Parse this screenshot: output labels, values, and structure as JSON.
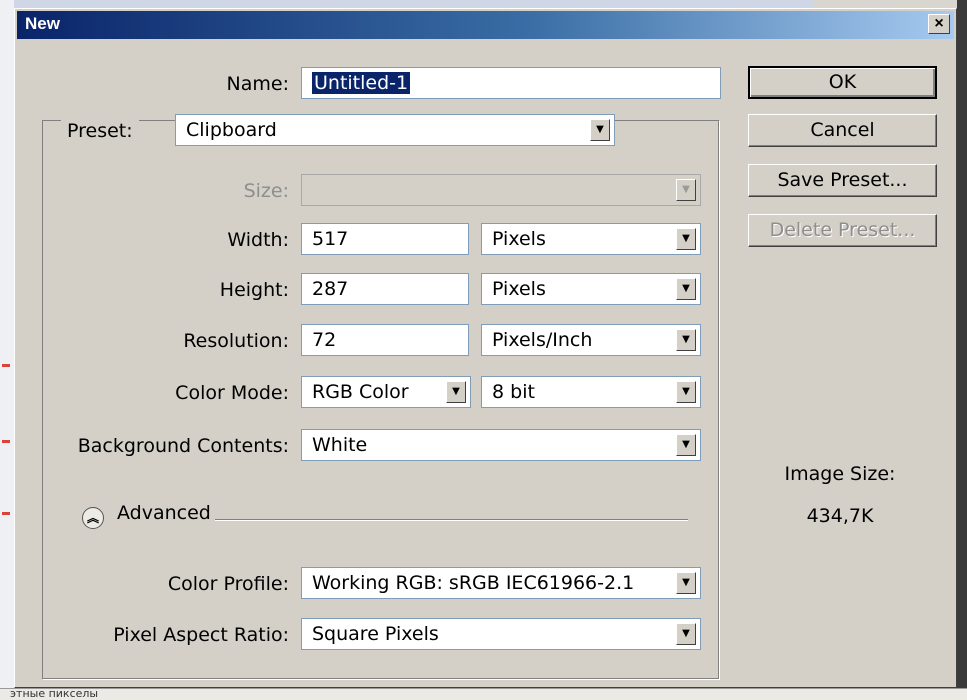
{
  "background": {
    "bottom_text": "этные пикселы"
  },
  "dialog": {
    "title": "New",
    "close_glyph": "×"
  },
  "form": {
    "name_label": "Name:",
    "name_value": "Untitled-1",
    "preset_label": "Preset:",
    "preset_value": "Clipboard",
    "size_label": "Size:",
    "size_value": "",
    "width_label": "Width:",
    "width_value": "517",
    "width_unit": "Pixels",
    "height_label": "Height:",
    "height_value": "287",
    "height_unit": "Pixels",
    "resolution_label": "Resolution:",
    "resolution_value": "72",
    "resolution_unit": "Pixels/Inch",
    "color_mode_label": "Color Mode:",
    "color_mode_value": "RGB Color",
    "bit_depth_value": "8 bit",
    "background_label": "Background Contents:",
    "background_value": "White",
    "advanced_label": "Advanced",
    "color_profile_label": "Color Profile:",
    "color_profile_value": "Working RGB:  sRGB IEC61966-2.1",
    "aspect_label": "Pixel Aspect Ratio:",
    "aspect_value": "Square Pixels"
  },
  "buttons": {
    "ok": "OK",
    "cancel": "Cancel",
    "save_preset": "Save Preset...",
    "delete_preset": "Delete Preset..."
  },
  "info": {
    "image_size_label": "Image Size:",
    "image_size_value": "434,7K"
  },
  "colors": {
    "title_gradient_start": "#0a246a",
    "title_gradient_end": "#a6caf0",
    "dialog_face": "#d4d0c8",
    "selection_highlight": "#0a246a"
  },
  "icons": {
    "dropdown": "triangle-down-icon",
    "advanced": "double-chevron-up-icon",
    "close": "close-icon"
  }
}
